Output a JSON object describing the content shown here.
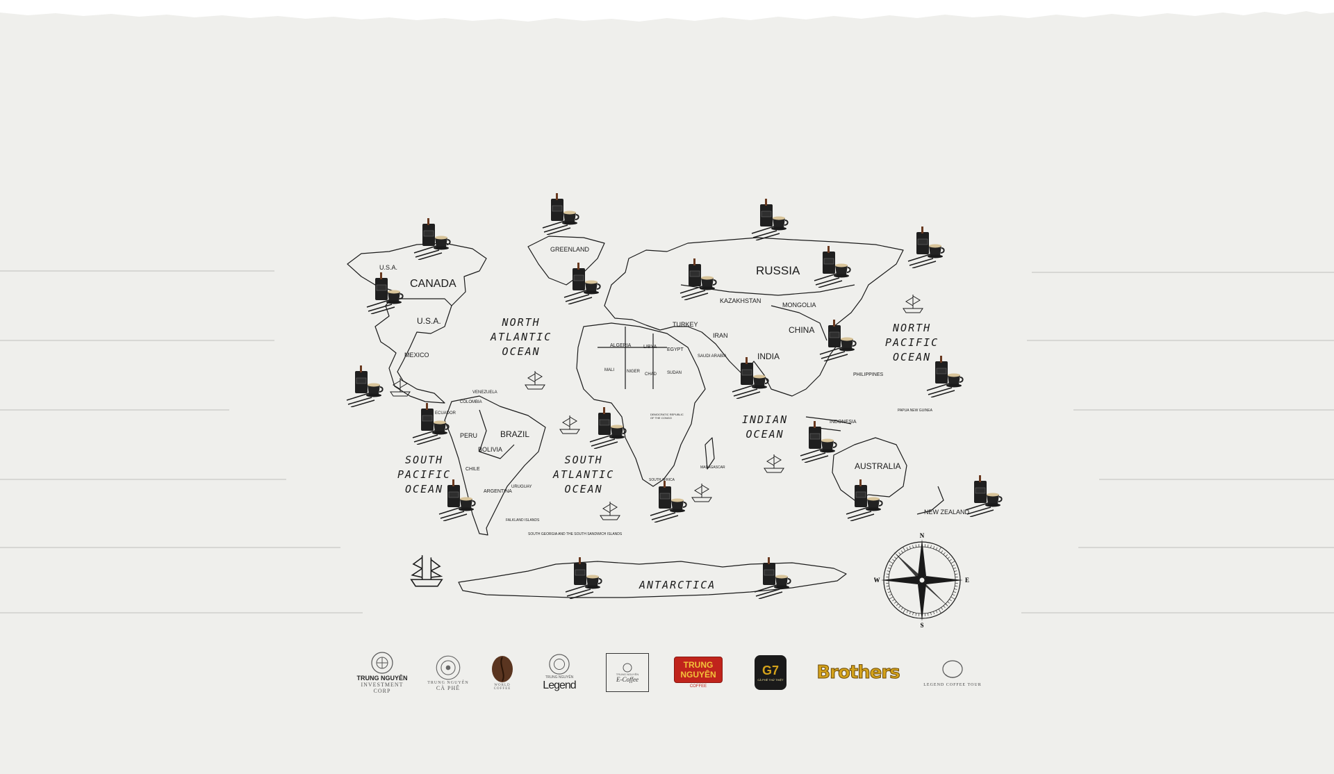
{
  "map": {
    "countries": {
      "canada": "CANADA",
      "usa_top": "U.S.A.",
      "usa": "U.S.A.",
      "greenland": "GREENLAND",
      "russia": "RUSSIA",
      "kazakhstan": "KAZAKHSTAN",
      "mongolia": "MONGOLIA",
      "china": "CHINA",
      "india": "INDIA",
      "iran": "IRAN",
      "mexico": "MEXICO",
      "brazil": "BRAZIL",
      "bolivia": "BOLIVIA",
      "peru": "PERU",
      "chile": "CHILE",
      "argentina": "ARGENTINA",
      "colombia": "COLOMBIA",
      "venezuela": "VENEZUELA",
      "algeria": "ALGERIA",
      "libya": "LIBYA",
      "egypt": "EGYPT",
      "sudan": "SUDAN",
      "chad": "CHAD",
      "niger": "NIGER",
      "mali": "MALI",
      "drc": "DEMOCRATIC REPUBLIC OF THE CONGO",
      "south_africa": "SOUTH AFRICA",
      "madagascar": "MADAGASCAR",
      "philippines": "PHILIPPINES",
      "indonesia": "INDONESIA",
      "australia": "AUSTRALIA",
      "new_zealand": "NEW ZEALAND",
      "papua": "PAPUA NEW GUINEA",
      "turkey": "TURKEY",
      "saudi": "SAUDI ARABIA",
      "ecuador": "ECUADOR",
      "uruguay": "URUGUAY",
      "falkland": "FALKLAND ISLANDS",
      "sgeorgia": "SOUTH GEORGIA AND THE SOUTH SANDWICH ISLANDS"
    },
    "oceans": {
      "north_atlantic": [
        "NORTH",
        "ATLANTIC",
        "OCEAN"
      ],
      "north_pacific": [
        "NORTH",
        "PACIFIC",
        "OCEAN"
      ],
      "south_pacific": [
        "SOUTH",
        "PACIFIC",
        "OCEAN"
      ],
      "south_atlantic": [
        "SOUTH",
        "ATLANTIC",
        "OCEAN"
      ],
      "indian": [
        "INDIAN",
        "OCEAN"
      ],
      "antarctica": "ANTARCTICA"
    },
    "compass": {
      "n": "N",
      "s": "S",
      "e": "E",
      "w": "W"
    }
  },
  "logos": [
    {
      "name": "TRUNG NGUYÊN",
      "sub": "INVESTMENT CORP"
    },
    {
      "name": "TRUNG NGUYÊN",
      "sub": "CÀ PHÊ"
    },
    {
      "name": "WORLD",
      "sub": "COFFEE"
    },
    {
      "name": "TRUNG NGUYÊN",
      "sub": "Legend"
    },
    {
      "name": "TRUNG NGUYÊN",
      "sub": "E-Coffee"
    },
    {
      "name": "TRUNG NGUYÊN",
      "sub": "COFFEE"
    },
    {
      "name": "G7",
      "sub": "CÀ PHÊ THỨ THIỆT"
    },
    {
      "name": "Brothers",
      "sub": ""
    },
    {
      "name": "LEGEND COFFEE TOUR",
      "sub": ""
    }
  ],
  "colors": {
    "background": "#efefec",
    "ink": "#1a1a1a",
    "logo_red": "#c0241c",
    "logo_gold": "#d4a21a"
  }
}
